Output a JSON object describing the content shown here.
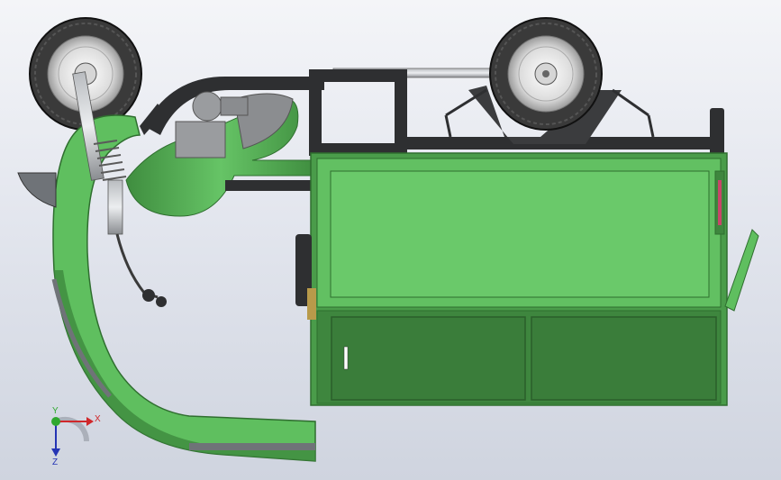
{
  "viewport": {
    "background_top": "#f4f5f8",
    "background_bottom": "#cfd4df"
  },
  "model": {
    "body_color": "#5fbf5f",
    "body_dark": "#3e8a3e",
    "panel_light": "#6ac96a",
    "frame_color": "#2e2f31",
    "tire_color": "#3a3a3a",
    "rim_color": "#e4e4e4"
  },
  "triad": {
    "x_label": "X",
    "y_label": "Y",
    "z_label": "Z",
    "x_color": "#d0282b",
    "y_color": "#2fa82f",
    "z_color": "#2434b4"
  }
}
